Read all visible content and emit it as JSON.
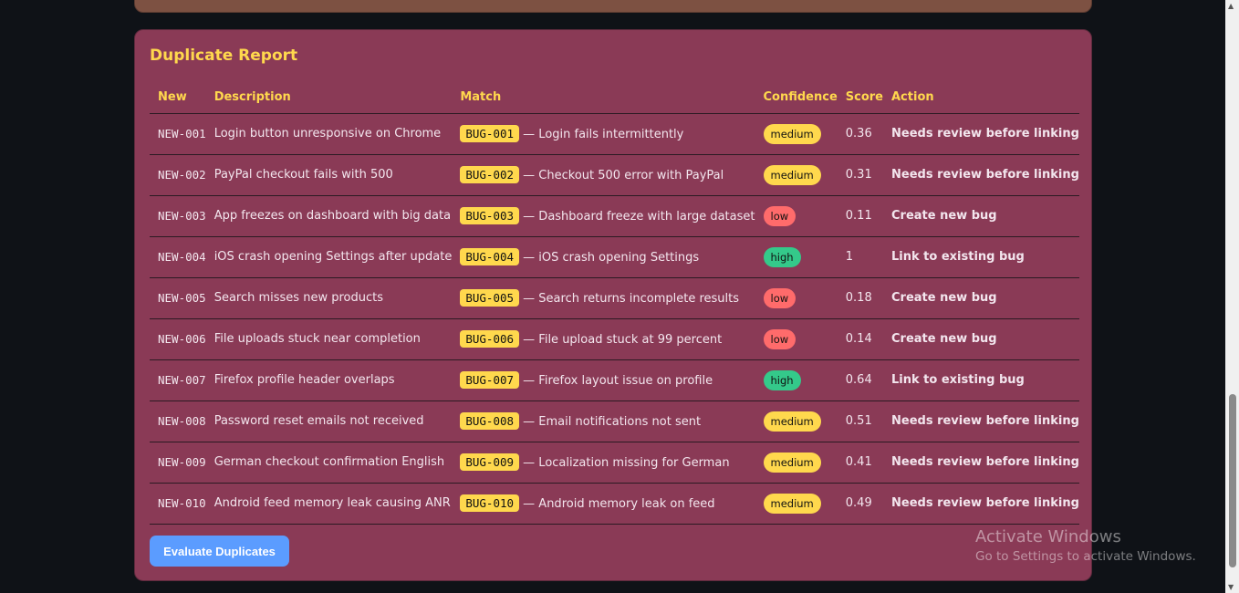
{
  "title": "Duplicate Report",
  "columns": [
    "New",
    "Description",
    "Match",
    "Confidence",
    "Score",
    "Action"
  ],
  "rows": [
    {
      "id": "NEW-001",
      "desc": "Login button unresponsive on Chrome",
      "bug": "BUG-001",
      "match": "— Login fails intermittently",
      "conf": "medium",
      "score": "0.36",
      "action": "Needs review before linking"
    },
    {
      "id": "NEW-002",
      "desc": "PayPal checkout fails with 500",
      "bug": "BUG-002",
      "match": "— Checkout 500 error with PayPal",
      "conf": "medium",
      "score": "0.31",
      "action": "Needs review before linking"
    },
    {
      "id": "NEW-003",
      "desc": "App freezes on dashboard with big data",
      "bug": "BUG-003",
      "match": "— Dashboard freeze with large dataset",
      "conf": "low",
      "score": "0.11",
      "action": "Create new bug"
    },
    {
      "id": "NEW-004",
      "desc": "iOS crash opening Settings after update",
      "bug": "BUG-004",
      "match": "— iOS crash opening Settings",
      "conf": "high",
      "score": "1",
      "action": "Link to existing bug"
    },
    {
      "id": "NEW-005",
      "desc": "Search misses new products",
      "bug": "BUG-005",
      "match": "— Search returns incomplete results",
      "conf": "low",
      "score": "0.18",
      "action": "Create new bug"
    },
    {
      "id": "NEW-006",
      "desc": "File uploads stuck near completion",
      "bug": "BUG-006",
      "match": "— File upload stuck at 99 percent",
      "conf": "low",
      "score": "0.14",
      "action": "Create new bug"
    },
    {
      "id": "NEW-007",
      "desc": "Firefox profile header overlaps",
      "bug": "BUG-007",
      "match": "— Firefox layout issue on profile",
      "conf": "high",
      "score": "0.64",
      "action": "Link to existing bug"
    },
    {
      "id": "NEW-008",
      "desc": "Password reset emails not received",
      "bug": "BUG-008",
      "match": "— Email notifications not sent",
      "conf": "medium",
      "score": "0.51",
      "action": "Needs review before linking"
    },
    {
      "id": "NEW-009",
      "desc": "German checkout confirmation English",
      "bug": "BUG-009",
      "match": "— Localization missing for German",
      "conf": "medium",
      "score": "0.41",
      "action": "Needs review before linking"
    },
    {
      "id": "NEW-010",
      "desc": "Android feed memory leak causing ANR",
      "bug": "BUG-010",
      "match": "— Android memory leak on feed",
      "conf": "medium",
      "score": "0.49",
      "action": "Needs review before linking"
    }
  ],
  "button": "Evaluate Duplicates",
  "watermark": {
    "line1": "Activate Windows",
    "line2": "Go to Settings to activate Windows."
  }
}
